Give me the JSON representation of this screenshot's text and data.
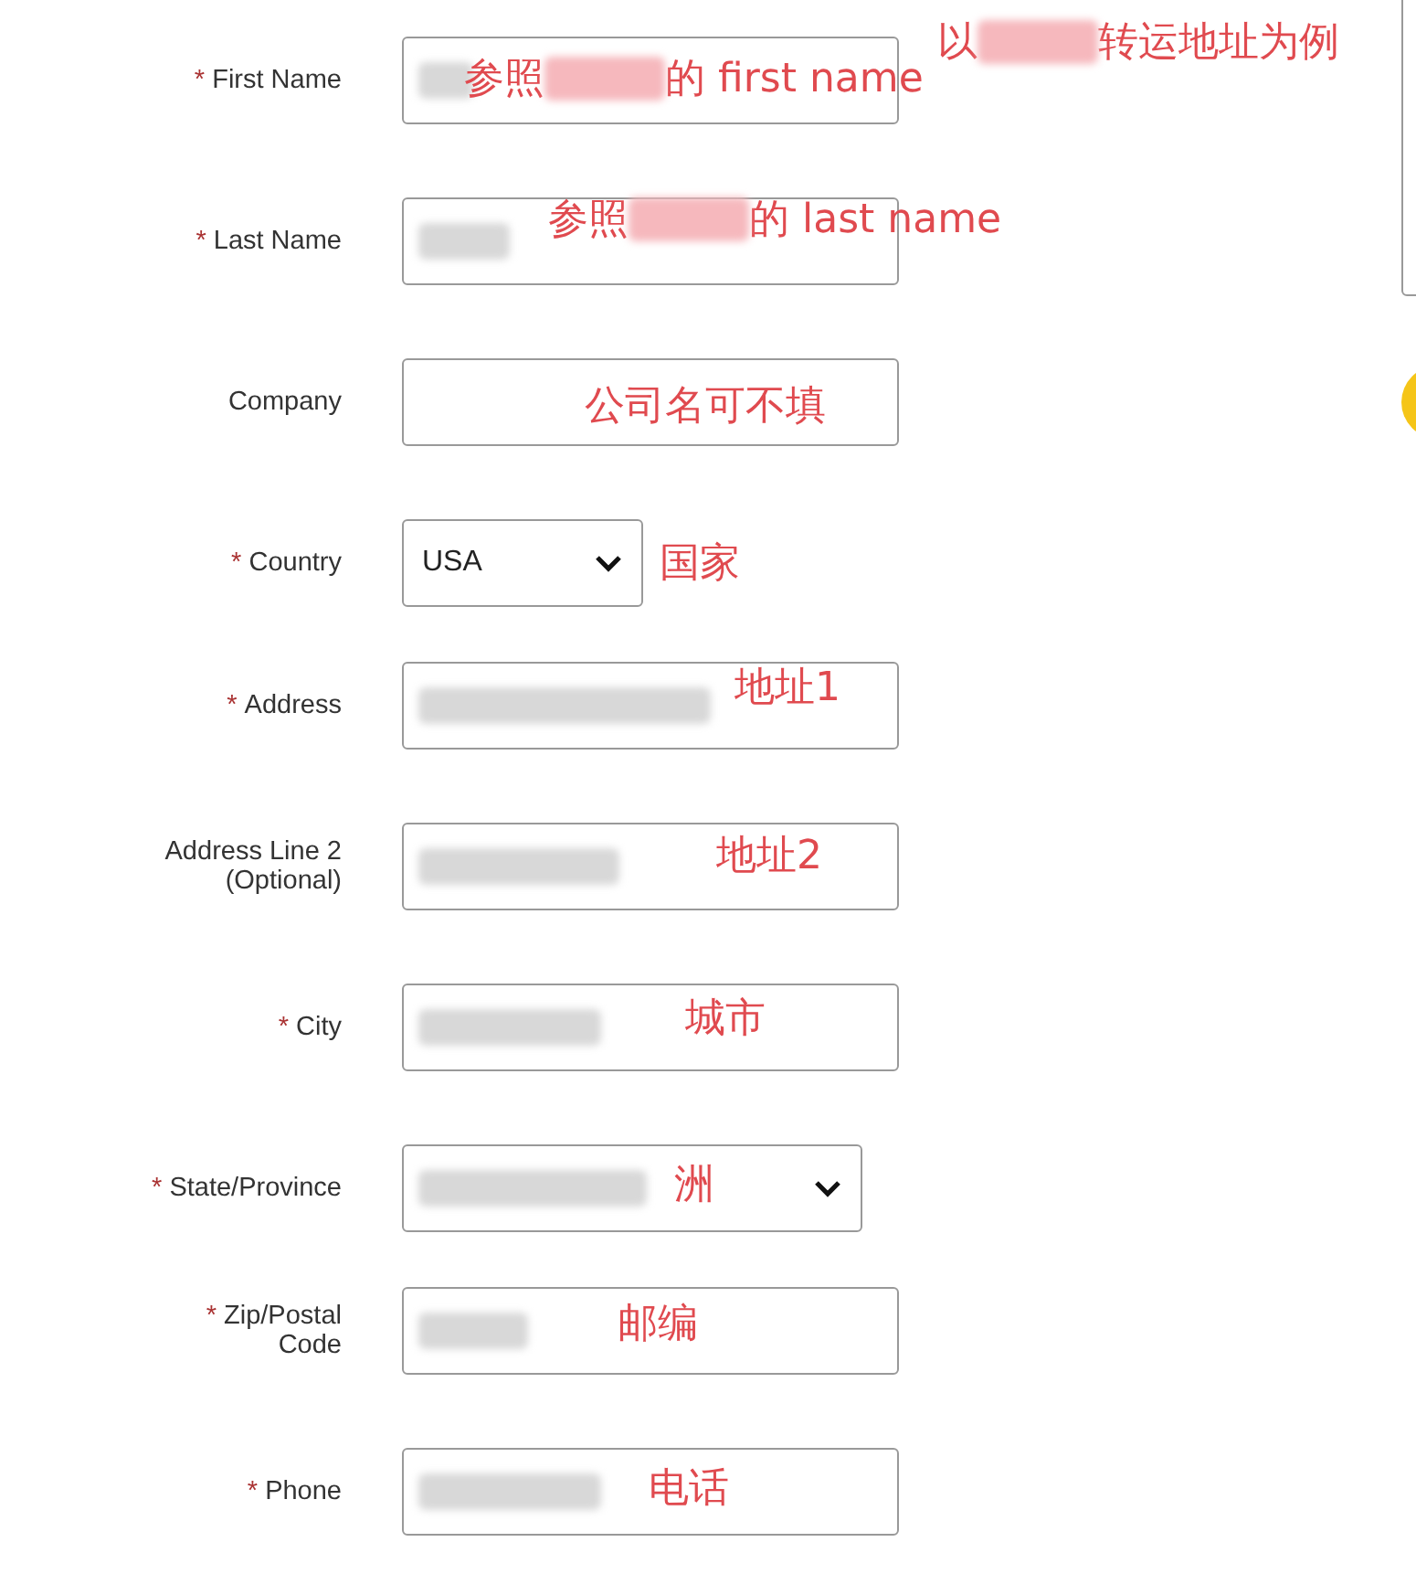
{
  "top_note": [
    "以",
    "转运地址为例"
  ],
  "fields": [
    {
      "marker": "*",
      "label": "First Name",
      "kind": "text",
      "redacted": true,
      "note": [
        "参照",
        "的 first name"
      ]
    },
    {
      "marker": "*",
      "label": "Last Name",
      "kind": "text",
      "redacted": true,
      "note": [
        "参照",
        "的 last name"
      ]
    },
    {
      "label": "Company",
      "kind": "text",
      "redacted": false,
      "note": [
        "公司名可不填"
      ]
    },
    {
      "marker": "*",
      "label": "Country",
      "kind": "select",
      "value": "USA",
      "redacted": false,
      "note": [
        "国家"
      ]
    },
    {
      "marker": "*",
      "label": "Address",
      "kind": "text",
      "redacted": true,
      "note": [
        "地址1"
      ]
    },
    {
      "label": "Address Line 2 (Optional)",
      "kind": "text",
      "redacted": true,
      "note": [
        "地址2"
      ]
    },
    {
      "marker": "*",
      "label": "City",
      "kind": "text",
      "redacted": true,
      "note": [
        "城市"
      ]
    },
    {
      "marker": "*",
      "label": "State/Province",
      "kind": "select",
      "redacted": true,
      "note": [
        "洲"
      ]
    },
    {
      "marker": "*",
      "label": "Zip/Postal Code",
      "kind": "text",
      "redacted": true,
      "note": [
        "邮编"
      ]
    },
    {
      "marker": "*",
      "label": "Phone",
      "kind": "text",
      "redacted": true,
      "note": [
        "电话"
      ]
    }
  ]
}
